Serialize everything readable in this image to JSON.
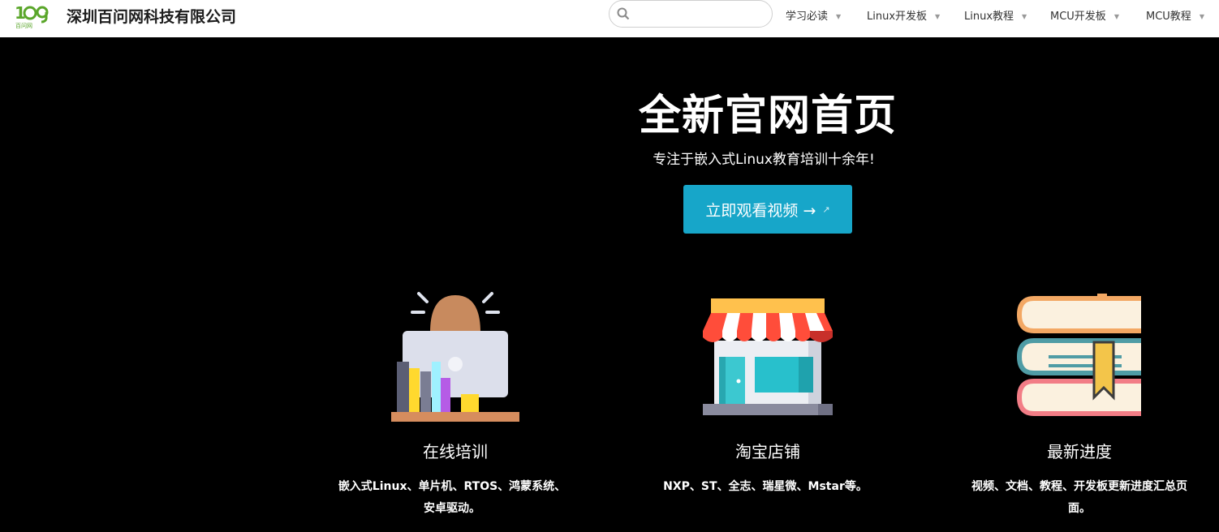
{
  "header": {
    "logo_text": "百问网",
    "company": "深圳百问网科技有限公司",
    "search": {
      "value": "",
      "placeholder": ""
    },
    "nav": [
      {
        "label": "学习必读"
      },
      {
        "label": "Linux开发板"
      },
      {
        "label": "Linux教程"
      },
      {
        "label": "MCU开发板"
      },
      {
        "label": "MCU教程"
      }
    ]
  },
  "hero": {
    "title": "全新官网首页",
    "subtitle": "专注于嵌入式Linux教育培训十余年!",
    "cta_label": "立即观看视频 →"
  },
  "features": [
    {
      "title": "在线培训",
      "desc_line1": "嵌入式Linux、单片机、RTOS、鸿蒙系统、",
      "desc_line2": "安卓驱动。",
      "icon": "online-training-icon"
    },
    {
      "title": "淘宝店铺",
      "desc_line1": "NXP、ST、全志、瑞星微、Mstar等。",
      "desc_line2": "",
      "icon": "storefront-icon"
    },
    {
      "title": "最新进度",
      "desc_line1": "视频、文档、教程、开发板更新进度汇总页",
      "desc_line2": "面。",
      "icon": "books-icon"
    }
  ],
  "colors": {
    "accent": "#17a6c9",
    "background": "#000000",
    "header_bg": "#ffffff",
    "logo_green": "#5aa62a"
  }
}
